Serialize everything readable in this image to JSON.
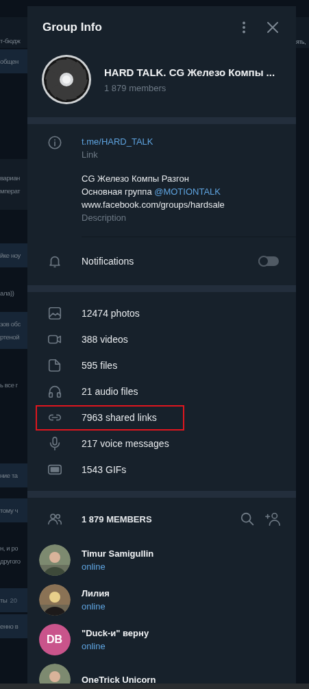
{
  "backdrop": {
    "left": [
      {
        "kind": "plain",
        "lines": [
          "т-бюдж"
        ]
      },
      {
        "kind": "bubble",
        "lines": [
          "общен"
        ]
      },
      {
        "kind": "card",
        "lines": [
          "вариан",
          "мперат"
        ]
      },
      {
        "kind": "bubble",
        "lines": [
          "йке ноу"
        ]
      },
      {
        "kind": "plain",
        "lines": [
          "ала))"
        ]
      },
      {
        "kind": "bubble",
        "lines": [
          "зов обс",
          "ртеной"
        ]
      },
      {
        "kind": "plain",
        "lines": [
          "ь все г"
        ]
      },
      {
        "kind": "bubble",
        "lines": [
          "ние та"
        ]
      },
      {
        "kind": "bubble",
        "lines": [
          "тому ч"
        ]
      },
      {
        "kind": "plain",
        "lines": [
          "н, и ро",
          "другого"
        ]
      },
      {
        "kind": "bubble",
        "lines": [
          "ты"
        ],
        "time": "20"
      },
      {
        "kind": "bubble",
        "lines": [
          "енно в"
        ]
      }
    ],
    "right": [
      {
        "lines": [
          "ять,"
        ]
      }
    ]
  },
  "window": {
    "title": "Group Info"
  },
  "group": {
    "name": "HARD TALK. CG Железо Компы ...",
    "members": "1 879 members"
  },
  "info": {
    "link": "t.me/HARD_TALK",
    "link_label": "Link",
    "description": [
      {
        "text": "CG Железо Компы Разгон"
      },
      {
        "text": "Основная группа ",
        "mention": "@MOTIONTALK"
      },
      {
        "text": "www.facebook.com/groups/hardsale"
      }
    ],
    "description_label": "Description"
  },
  "notifications": {
    "label": "Notifications",
    "on": false
  },
  "media": [
    {
      "kind": "photos",
      "label": "12474 photos",
      "highlighted": false
    },
    {
      "kind": "videos",
      "label": "388 videos",
      "highlighted": false
    },
    {
      "kind": "files",
      "label": "595 files",
      "highlighted": false
    },
    {
      "kind": "audio",
      "label": "21 audio files",
      "highlighted": false
    },
    {
      "kind": "links",
      "label": "7963 shared links",
      "highlighted": true
    },
    {
      "kind": "voice",
      "label": "217 voice messages",
      "highlighted": false
    },
    {
      "kind": "gifs",
      "label": "1543 GIFs",
      "highlighted": false
    }
  ],
  "members": {
    "title": "1 879 MEMBERS",
    "list": [
      {
        "name": "Timur Samigullin",
        "status": "online",
        "kind": "picture"
      },
      {
        "name": "Лилия",
        "status": "online",
        "kind": "picture"
      },
      {
        "name": "\"Duck-и\" верну",
        "status": "online",
        "kind": "initials",
        "initials": "DB",
        "color": "#c9548b"
      },
      {
        "name": "OneTrick Unicorn",
        "kind": "picture"
      }
    ]
  }
}
